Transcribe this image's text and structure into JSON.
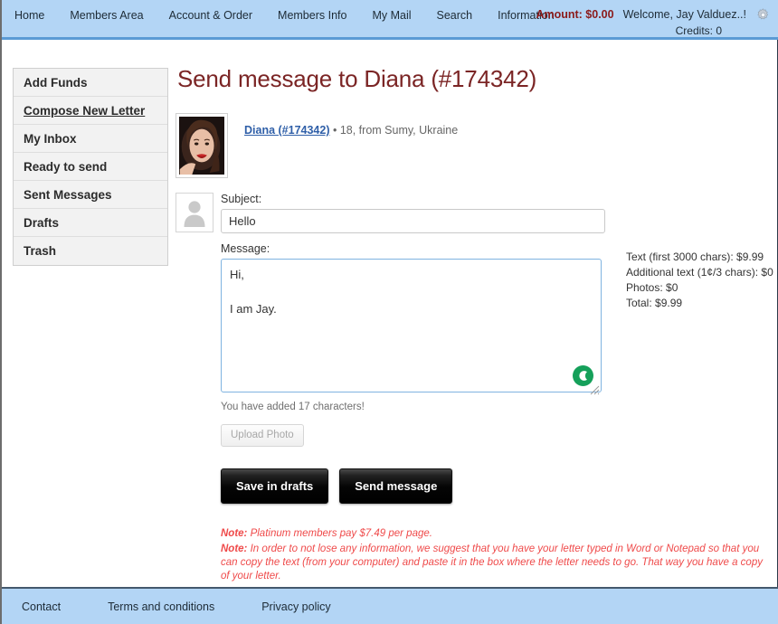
{
  "topnav": {
    "links": [
      "Home",
      "Members Area",
      "Account & Order",
      "Members Info",
      "My Mail",
      "Search",
      "Information"
    ],
    "amount": "Amount: $0.00",
    "welcome": "Welcome, Jay Valduez..!",
    "credits": "Credits: 0",
    "settings_icon": "gear-icon",
    "bg_color": "#b3d5f5",
    "amount_color": "#8b1a1a"
  },
  "sidebar": {
    "items": [
      {
        "label": "Add Funds",
        "active": false
      },
      {
        "label": "Compose New Letter",
        "active": true
      },
      {
        "label": "My Inbox",
        "active": false
      },
      {
        "label": "Ready to send",
        "active": false
      },
      {
        "label": "Sent Messages",
        "active": false
      },
      {
        "label": "Drafts",
        "active": false
      },
      {
        "label": "Trash",
        "active": false
      }
    ]
  },
  "main": {
    "title": "Send message to Diana (#174342)",
    "title_color": "#7b2525",
    "profile": {
      "photo_alt": "recipient-photo",
      "name_link": "Diana (#174342)",
      "details": " • 18, from Sumy, Ukraine"
    },
    "subject": {
      "label": "Subject:",
      "value": "Hello",
      "placeholder": "Subject"
    },
    "message": {
      "label": "Message:",
      "value": "Hi,\n\nI am Jay. ",
      "placeholder": "",
      "char_count": "You have added 17 characters!",
      "assistant_badge": "grammar-check-icon"
    },
    "upload_button": "Upload Photo",
    "save_button": "Save in drafts",
    "send_button": "Send message",
    "notes": [
      {
        "prefix": "Note:",
        "text": " Platinum members pay $7.49 per page."
      },
      {
        "prefix": "Note:",
        "text": " In order to not lose any information, we suggest that you have your letter typed in Word or Notepad so that you can copy the text (from your computer) and paste it in the box where the letter needs to go. That way you have a copy of your letter."
      }
    ],
    "note_color": "#ef4a4a"
  },
  "pricing": {
    "lines": [
      "Text (first 3000 chars): $9.99",
      "Additional text (1¢/3 chars): $0",
      "Photos: $0",
      "Total: $9.99"
    ]
  },
  "footer": {
    "links": [
      "Contact",
      "Terms and conditions",
      "Privacy policy"
    ]
  }
}
